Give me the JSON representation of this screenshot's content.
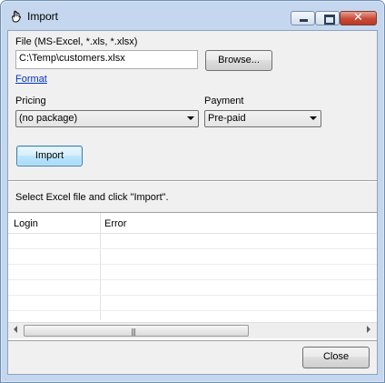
{
  "window": {
    "title": "Import"
  },
  "file": {
    "label": "File (MS-Excel, *.xls, *.xlsx)",
    "path": "C:\\Temp\\customers.xlsx",
    "browse_label": "Browse...",
    "format_link": "Format"
  },
  "pricing": {
    "label": "Pricing",
    "selected": "(no package)"
  },
  "payment": {
    "label": "Payment",
    "selected": "Pre-paid"
  },
  "import_button": "Import",
  "status": "Select Excel file and click \"Import\".",
  "grid": {
    "columns": [
      "Login",
      "Error"
    ],
    "rows": []
  },
  "close_button": "Close",
  "icons": {
    "window_icon": "hand-icon"
  }
}
